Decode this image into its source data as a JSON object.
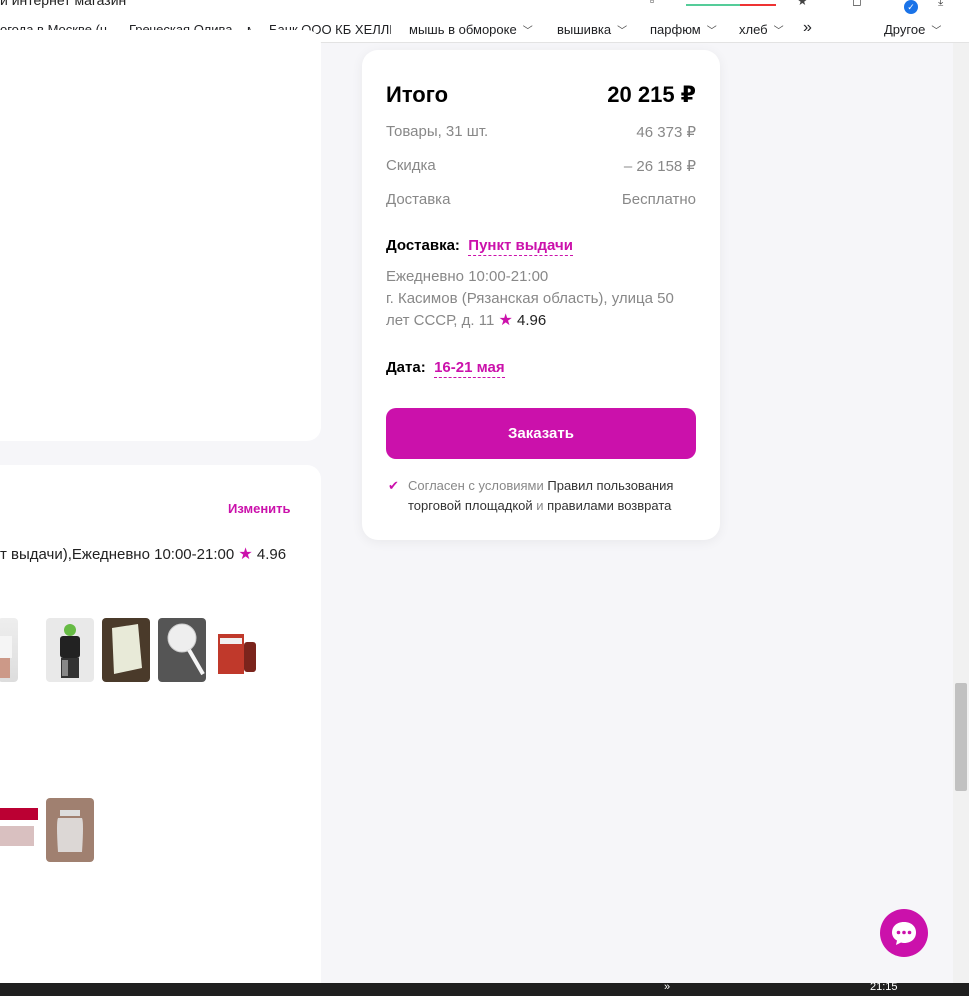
{
  "browser": {
    "tab_title": "й интернет магазин",
    "bookmarks": [
      {
        "label": "огода в Москве (ц",
        "folder": false
      },
      {
        "label": "Греческая Олива – м",
        "folder": false
      },
      {
        "label": "Банк ООО КБ ХЕЛЛЕ",
        "folder": false
      },
      {
        "label": "мышь в обмороке",
        "folder": true
      },
      {
        "label": "вышивка",
        "folder": true
      },
      {
        "label": "парфюм",
        "folder": true
      },
      {
        "label": "хлеб",
        "folder": true
      }
    ],
    "more_bookmarks": "»",
    "other_bookmarks": "Другое"
  },
  "summary": {
    "title": "Итого",
    "total": "20 215 ₽",
    "rows": [
      {
        "label": "Товары, 31 шт.",
        "value": "46 373 ₽"
      },
      {
        "label": "Скидка",
        "value": "– 26 158 ₽"
      },
      {
        "label": "Доставка",
        "value": "Бесплатно"
      }
    ],
    "delivery_label": "Доставка:",
    "delivery_type": "Пункт выдачи",
    "hours": "Ежедневно 10:00-21:00",
    "address": "г. Касимов (Рязанская область), улица 50 лет СССР, д. 11",
    "rating": "4.96",
    "date_label": "Дата:",
    "date_value": "16-21 мая",
    "order_button": "Заказать",
    "agree_prefix": "Согласен с условиями",
    "agree_link1": "Правил пользования торговой площадкой",
    "agree_and": "и",
    "agree_link2": "правилами возврата"
  },
  "delivery_section": {
    "change_link": "Изменить",
    "pickup_text": "т выдачи),Ежедневно 10:00-21:00",
    "rating": "4.96"
  },
  "taskbar": {
    "more": "»",
    "time": "21:15"
  },
  "colors": {
    "accent": "#cb11ab",
    "background": "#f6f6f9"
  }
}
